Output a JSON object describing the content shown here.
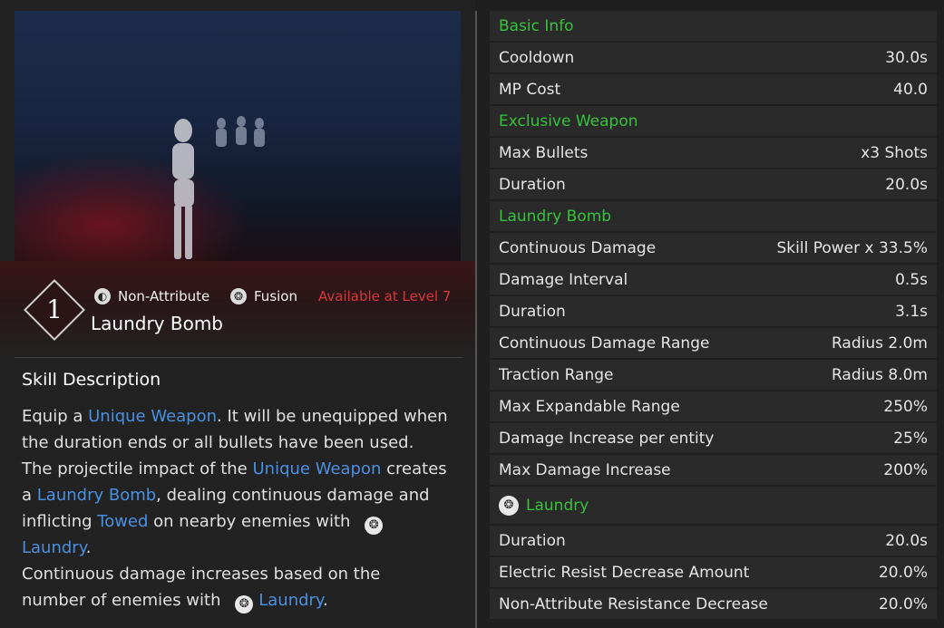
{
  "skill": {
    "level": "1",
    "attribute": "Non-Attribute",
    "type": "Fusion",
    "availability": "Available at Level 7",
    "name": "Laundry Bomb"
  },
  "description": {
    "title": "Skill Description",
    "p1": "Equip a ",
    "k1": "Unique Weapon",
    "p2": ". It will be unequipped when the duration ends or all bullets have been used. The projectile impact of the ",
    "k2": "Unique Weapon",
    "p3": " creates a ",
    "k3": "Laundry Bomb",
    "p4": ", dealing continuous damage and inflicting ",
    "k4": "Towed",
    "p5": " on nearby enemies with ",
    "k5": "Laundry",
    "p6": ".",
    "p7": "Continuous damage increases based on the number of enemies with ",
    "k6": "Laundry",
    "p8": "."
  },
  "stats": {
    "basic_info": "Basic Info",
    "cooldown_label": "Cooldown",
    "cooldown_value": "30.0s",
    "mp_label": "MP Cost",
    "mp_value": "40.0",
    "exclusive_weapon": "Exclusive Weapon",
    "max_bullets_label": "Max Bullets",
    "max_bullets_value": "x3 Shots",
    "weapon_duration_label": "Duration",
    "weapon_duration_value": "20.0s",
    "laundry_bomb": "Laundry Bomb",
    "cont_damage_label": "Continuous Damage",
    "cont_damage_value": "Skill Power x 33.5%",
    "interval_label": "Damage Interval",
    "interval_value": "0.5s",
    "bomb_duration_label": "Duration",
    "bomb_duration_value": "3.1s",
    "range_label": "Continuous Damage Range",
    "range_value": "Radius 2.0m",
    "traction_label": "Traction Range",
    "traction_value": "Radius 8.0m",
    "expand_label": "Max Expandable Range",
    "expand_value": "250%",
    "per_entity_label": "Damage Increase per entity",
    "per_entity_value": "25%",
    "max_increase_label": "Max Damage Increase",
    "max_increase_value": "200%",
    "laundry": "Laundry",
    "laundry_duration_label": "Duration",
    "laundry_duration_value": "20.0s",
    "electric_label": "Electric Resist Decrease Amount",
    "electric_value": "20.0%",
    "nonattr_label": "Non-Attribute Resistance Decrease",
    "nonattr_value": "20.0%"
  },
  "icons": {
    "attribute": "non-attribute-icon",
    "fusion": "fusion-icon",
    "laundry": "laundry-icon"
  },
  "colors": {
    "section": "#36c23a",
    "keyword": "#4a90e2",
    "availability": "#d8363a"
  }
}
